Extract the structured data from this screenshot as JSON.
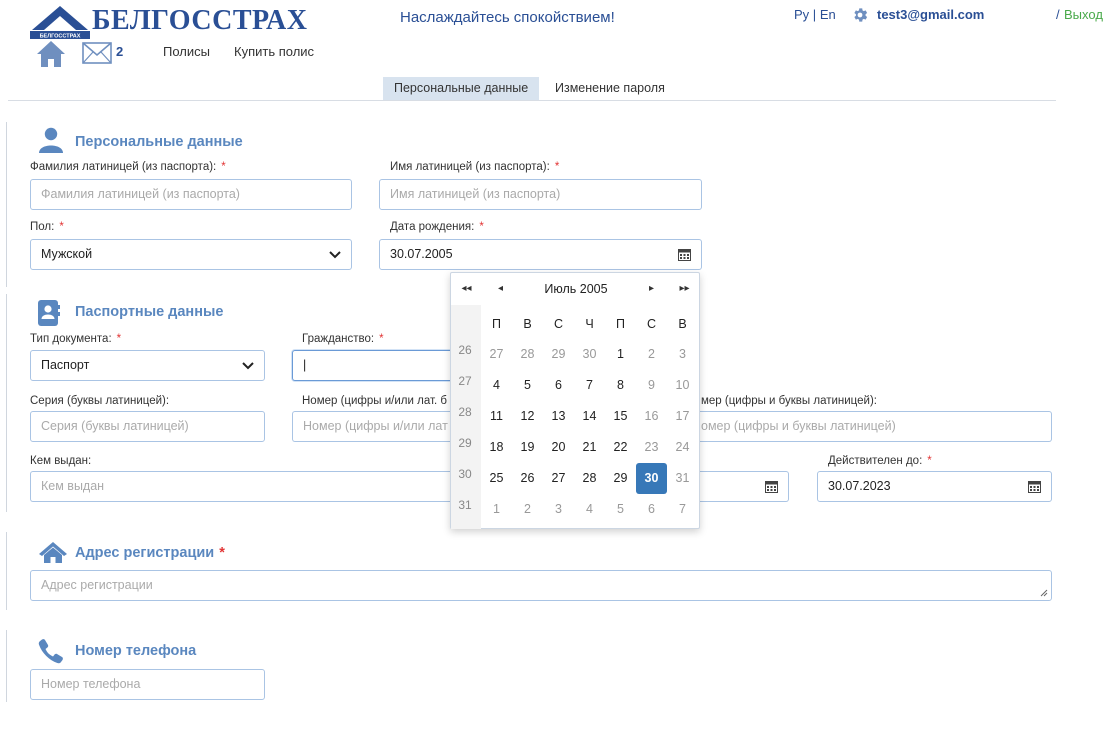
{
  "header": {
    "logo_text": "БЕЛГОССТРАХ",
    "logo_sub": "БЕЛГОССТРАХ",
    "tagline": "Наслаждайтесь спокойствием!",
    "lang_ru": "Ру",
    "lang_sep": "|",
    "lang_en": "En",
    "user_email": "test3@gmail.com",
    "logout_sep": "/",
    "logout": "Выход",
    "mail_count": "2",
    "nav": [
      "Полисы",
      "Купить полис"
    ]
  },
  "tabs": [
    "Персональные данные",
    "Изменение пароля"
  ],
  "personal": {
    "title": "Персональные данные",
    "surname_label": "Фамилия латиницей (из паспорта):",
    "surname_placeholder": "Фамилия латиницей (из паспорта)",
    "name_label": "Имя латиницей (из паспорта):",
    "name_placeholder": "Имя латиницей (из паспорта)",
    "gender_label": "Пол:",
    "gender_value": "Мужской",
    "dob_label": "Дата рождения:",
    "dob_value": "30.07.2005",
    "required_mark": "*"
  },
  "passport": {
    "title": "Паспортные данные",
    "doc_type_label": "Тип документа:",
    "doc_type_value": "Паспорт",
    "citizenship_label": "Гражданство:",
    "citizenship_value": "|",
    "series_label": "Серия (буквы латиницей):",
    "series_placeholder": "Серия (буквы латиницей)",
    "number_label": "Номер (цифры и/или лат. б",
    "number_placeholder": "Номер (цифры и/или лат",
    "id_label": "мер (цифры и буквы латиницей):",
    "id_placeholder": "омер (цифры и буквы латиницей)",
    "issued_by_label": "Кем выдан:",
    "issued_by_placeholder": "Кем выдан",
    "valid_until_label": "Действителен до:",
    "valid_until_value": "30.07.2023"
  },
  "address": {
    "title": "Адрес регистрации",
    "placeholder": "Адрес регистрации"
  },
  "phone": {
    "title": "Номер телефона",
    "placeholder": "Номер телефона"
  },
  "datepicker": {
    "title": "Июль 2005",
    "nav_prev_year": "◂◂",
    "nav_prev": "◂",
    "nav_next": "▸",
    "nav_next_year": "▸▸",
    "weekdays": [
      "П",
      "В",
      "С",
      "Ч",
      "П",
      "С",
      "В"
    ],
    "weeks": [
      {
        "num": "26",
        "days": [
          "27",
          "28",
          "29",
          "30",
          "1",
          "2",
          "3"
        ],
        "muted": [
          true,
          true,
          true,
          true,
          false,
          true,
          true
        ]
      },
      {
        "num": "27",
        "days": [
          "4",
          "5",
          "6",
          "7",
          "8",
          "9",
          "10"
        ],
        "muted": [
          false,
          false,
          false,
          false,
          false,
          true,
          true
        ]
      },
      {
        "num": "28",
        "days": [
          "11",
          "12",
          "13",
          "14",
          "15",
          "16",
          "17"
        ],
        "muted": [
          false,
          false,
          false,
          false,
          false,
          true,
          true
        ]
      },
      {
        "num": "29",
        "days": [
          "18",
          "19",
          "20",
          "21",
          "22",
          "23",
          "24"
        ],
        "muted": [
          false,
          false,
          false,
          false,
          false,
          true,
          true
        ]
      },
      {
        "num": "30",
        "days": [
          "25",
          "26",
          "27",
          "28",
          "29",
          "30",
          "31"
        ],
        "muted": [
          false,
          false,
          false,
          false,
          false,
          false,
          true
        ]
      },
      {
        "num": "31",
        "days": [
          "1",
          "2",
          "3",
          "4",
          "5",
          "6",
          "7"
        ],
        "muted": [
          true,
          true,
          true,
          true,
          true,
          true,
          true
        ]
      }
    ],
    "selected": "30"
  },
  "colors": {
    "brand": "#2a4f95",
    "accent": "#5a87bf",
    "logout": "#49a94a",
    "required": "#e23434",
    "selected_day": "#3778b8"
  }
}
